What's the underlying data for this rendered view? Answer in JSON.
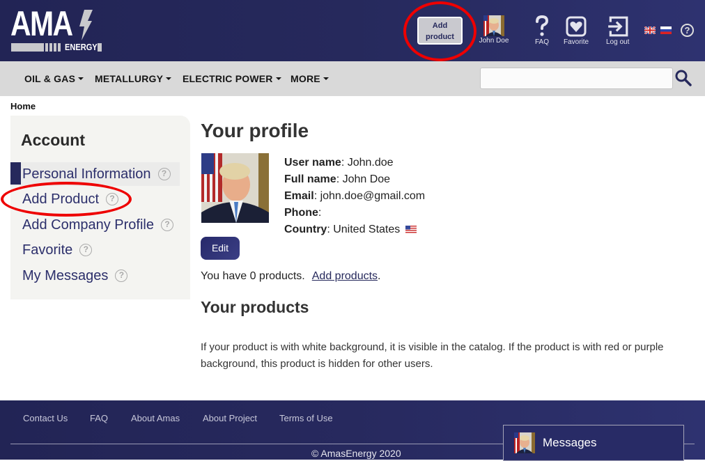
{
  "header": {
    "logo_text": "AMA",
    "logo_subtext": "ENERGY",
    "add_product_line1": "Add",
    "add_product_line2": "product",
    "user_name": "John Doe",
    "faq_label": "FAQ",
    "favorite_label": "Favorite",
    "logout_label": "Log out",
    "help_glyph": "?",
    "languages": [
      "English",
      "Russian"
    ]
  },
  "nav": {
    "items": [
      {
        "label": "OIL & GAS"
      },
      {
        "label": "METALLURGY"
      },
      {
        "label": "ELECTRIC POWER"
      },
      {
        "label": "MORE"
      }
    ],
    "search_value": ""
  },
  "breadcrumb": "Home",
  "sidebar": {
    "title": "Account",
    "items": [
      {
        "label": "Personal Information",
        "active": true
      },
      {
        "label": "Add Product"
      },
      {
        "label": "Add Company Profile"
      },
      {
        "label": "Favorite"
      },
      {
        "label": "My Messages"
      }
    ],
    "help_glyph": "?"
  },
  "profile": {
    "title": "Your profile",
    "fields": [
      {
        "label": "User name",
        "value": "John.doe"
      },
      {
        "label": "Full name",
        "value": "John Doe"
      },
      {
        "label": "Email",
        "value": "john.doe@gmail.com"
      },
      {
        "label": "Phone",
        "value": ""
      },
      {
        "label": "Country",
        "value": "United States"
      }
    ],
    "edit_label": "Edit",
    "products_count_text": "You have 0 products.",
    "add_products_link": "Add products",
    "period": "."
  },
  "products": {
    "title": "Your products",
    "info": "If your product is with white background, it is visible in the catalog. If the product is with red or purple background, this product is hidden for other users."
  },
  "footer": {
    "links": [
      "Contact Us",
      "FAQ",
      "About Amas",
      "About Project",
      "Terms of Use"
    ],
    "copyright": "© AmasEnergy 2020",
    "messages_label": "Messages"
  },
  "colors": {
    "brand_navy": "#26295c",
    "nav_gray": "#d9d9d9",
    "annotation_red": "#e00000"
  }
}
